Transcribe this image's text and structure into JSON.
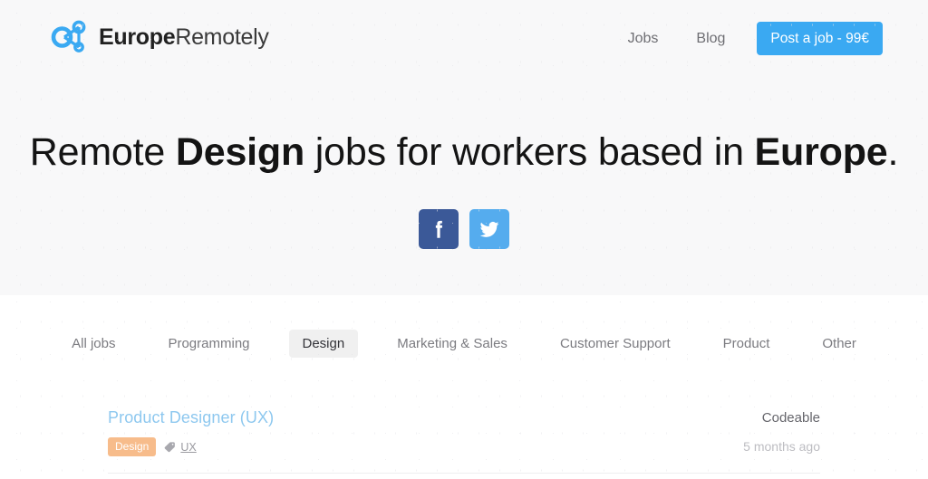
{
  "brand": {
    "logo_icon": "network-nodes-icon",
    "name_bold": "Europe",
    "name_regular": "Remotely"
  },
  "header": {
    "nav": [
      {
        "label": "Jobs",
        "name": "nav-link-jobs"
      },
      {
        "label": "Blog",
        "name": "nav-link-blog"
      }
    ],
    "cta_label": "Post a job - 99€",
    "cta_color": "#3aa9f2"
  },
  "hero": {
    "headline_part1": "Remote ",
    "headline_bold1": "Design",
    "headline_part2": " jobs for workers based in ",
    "headline_bold2": "Europe",
    "headline_part3": ".",
    "background": "#f8f8f9",
    "socials": [
      {
        "name": "facebook-share-button",
        "icon": "facebook-icon",
        "color": "#3b5998"
      },
      {
        "name": "twitter-share-button",
        "icon": "twitter-icon",
        "color": "#55acee"
      }
    ]
  },
  "tabs": {
    "active": "Design",
    "items": [
      {
        "label": "All jobs",
        "name": "tab-all-jobs",
        "active": false
      },
      {
        "label": "Programming",
        "name": "tab-programming",
        "active": false
      },
      {
        "label": "Design",
        "name": "tab-design",
        "active": true
      },
      {
        "label": "Marketing & Sales",
        "name": "tab-marketing-sales",
        "active": false
      },
      {
        "label": "Customer Support",
        "name": "tab-customer-support",
        "active": false
      },
      {
        "label": "Product",
        "name": "tab-product",
        "active": false
      },
      {
        "label": "Other",
        "name": "tab-other",
        "active": false
      }
    ]
  },
  "jobs": [
    {
      "title": "Product Designer (UX)",
      "category": "Design",
      "category_color": "#f7bc8b",
      "tag_icon": "tag-icon",
      "tag": "UX",
      "company": "Codeable",
      "posted": "5 months ago"
    }
  ]
}
